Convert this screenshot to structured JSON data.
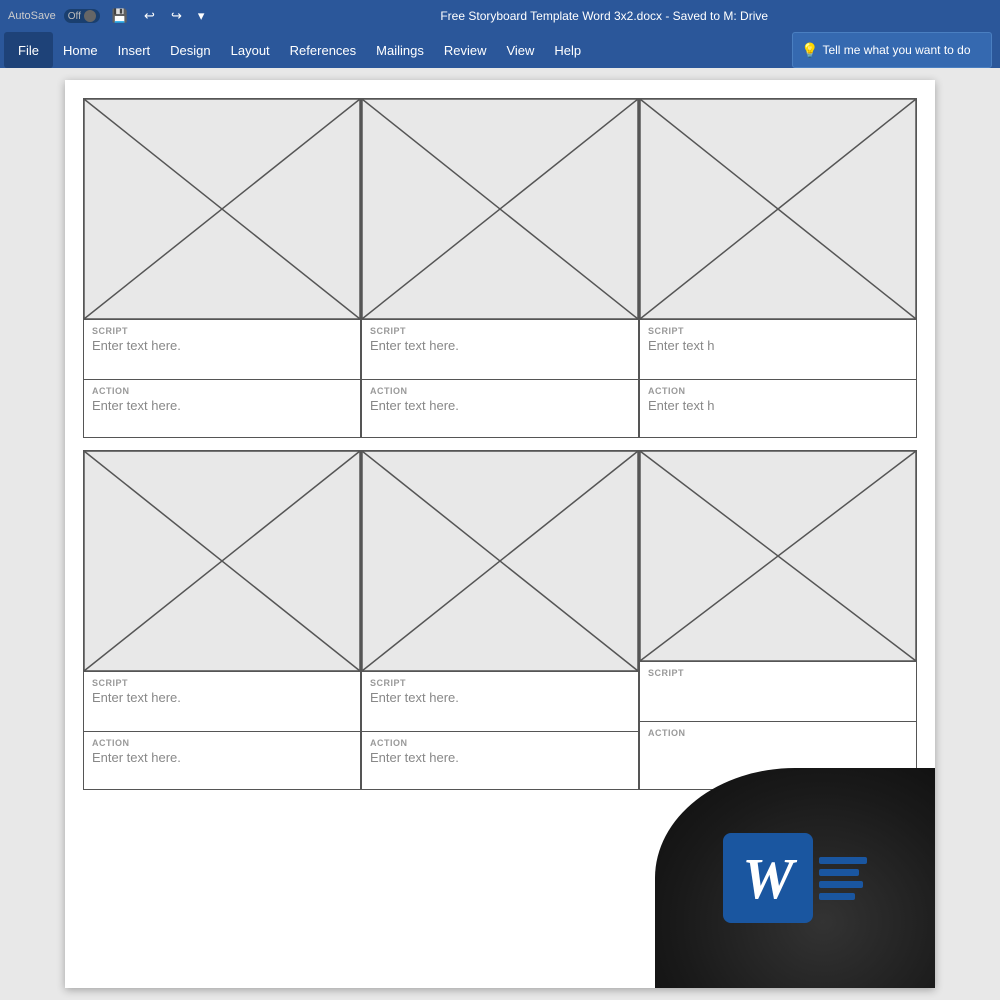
{
  "titleBar": {
    "autosave": "AutoSave",
    "offLabel": "Off",
    "title": "Free Storyboard Template Word 3x2.docx  -  Saved to M: Drive"
  },
  "menuBar": {
    "items": [
      "File",
      "Home",
      "Insert",
      "Design",
      "Layout",
      "References",
      "Mailings",
      "Review",
      "View",
      "Help"
    ],
    "tellMe": "Tell me what you want to do"
  },
  "storyboard": {
    "row1": [
      {
        "scriptLabel": "SCRIPT",
        "scriptText": "Enter text here.",
        "actionLabel": "ACTION",
        "actionText": "Enter text here."
      },
      {
        "scriptLabel": "SCRIPT",
        "scriptText": "Enter text here.",
        "actionLabel": "ACTION",
        "actionText": "Enter text here."
      },
      {
        "scriptLabel": "SCRIPT",
        "scriptText": "Enter text h",
        "actionLabel": "ACTION",
        "actionText": "Enter text h"
      }
    ],
    "row2": [
      {
        "scriptLabel": "SCRIPT",
        "scriptText": "Enter text here.",
        "actionLabel": "ACTION",
        "actionText": "Enter text here."
      },
      {
        "scriptLabel": "SCRIPT",
        "scriptText": "Enter text here.",
        "actionLabel": "ACTION",
        "actionText": "Enter text here."
      },
      {
        "scriptLabel": "SCRIPT",
        "scriptText": "",
        "actionLabel": "ACTION",
        "actionText": ""
      }
    ]
  },
  "wordLogo": {
    "letter": "W"
  }
}
